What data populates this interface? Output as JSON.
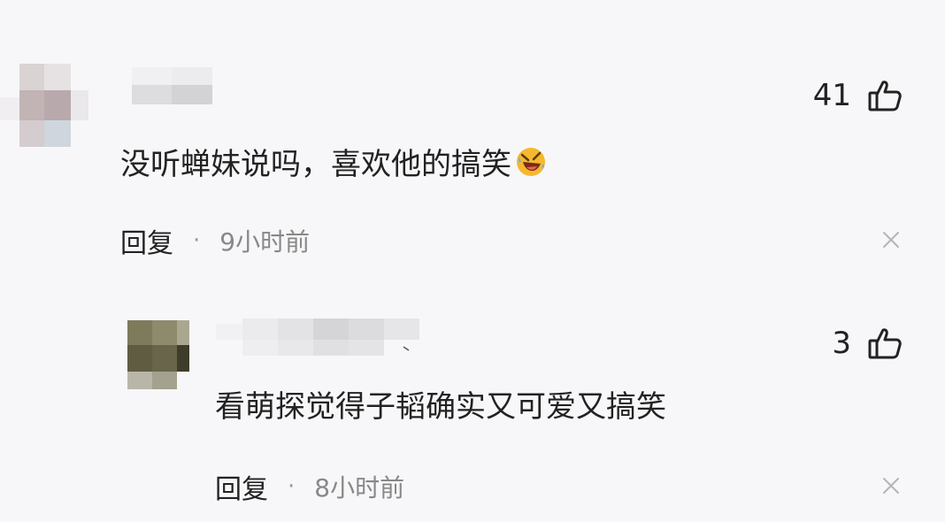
{
  "comments": [
    {
      "likes": "41",
      "text": "没听蝉妹说吗，喜欢他的搞笑",
      "emoji": "rolling-on-floor-laughing-emoji",
      "reply_label": "回复",
      "separator": "·",
      "time": "9小时前"
    },
    {
      "likes": "3",
      "text": "看萌探觉得子韬确实又可爱又搞笑",
      "reply_label": "回复",
      "separator": "·",
      "time": "8小时前"
    }
  ],
  "icons": {
    "like": "thumb-up-icon",
    "close": "close-icon"
  },
  "colors": {
    "background": "#f7f7f9",
    "text": "#222222",
    "meta": "#888888"
  }
}
